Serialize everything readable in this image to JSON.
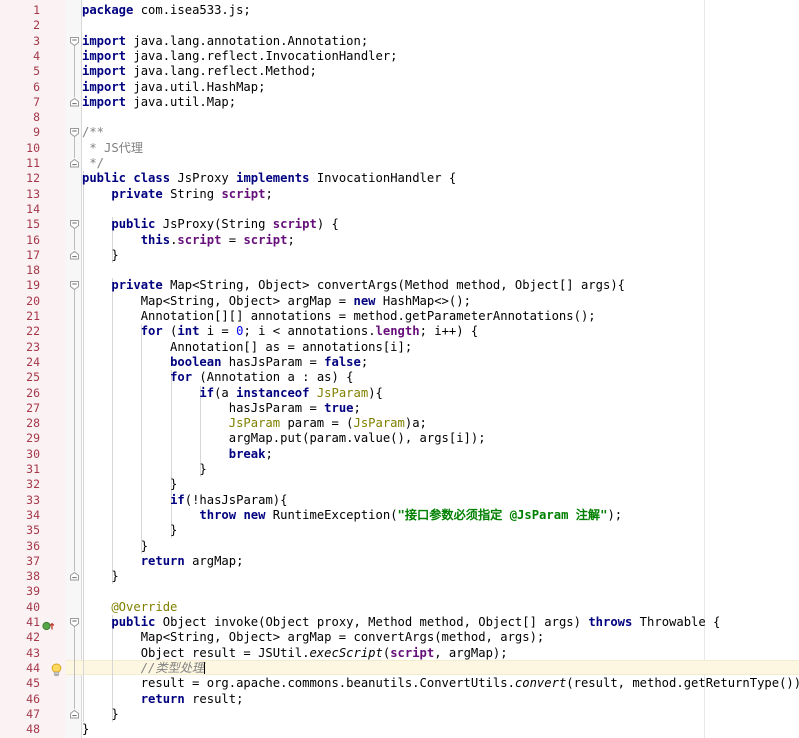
{
  "editor": {
    "language": "java",
    "file_package": "com.isea533.js",
    "class_name": "JsProxy",
    "colors": {
      "background": "#ffffff",
      "gutter_background": "#fbf2f4",
      "line_number": "#a5394a",
      "keyword": "#000080",
      "string": "#008000",
      "comment": "#808080",
      "annotation": "#808000",
      "field": "#660e7a",
      "number": "#0000ff",
      "caret_line": "#fdf7e2"
    },
    "caret_line_number": 44,
    "first_line": 1,
    "last_line": 48,
    "lines": [
      {
        "n": 1,
        "text": "package com.isea533.js;"
      },
      {
        "n": 2,
        "text": ""
      },
      {
        "n": 3,
        "text": "import java.lang.annotation.Annotation;"
      },
      {
        "n": 4,
        "text": "import java.lang.reflect.InvocationHandler;"
      },
      {
        "n": 5,
        "text": "import java.lang.reflect.Method;"
      },
      {
        "n": 6,
        "text": "import java.util.HashMap;"
      },
      {
        "n": 7,
        "text": "import java.util.Map;"
      },
      {
        "n": 8,
        "text": ""
      },
      {
        "n": 9,
        "text": "/**"
      },
      {
        "n": 10,
        "text": " * JS代理"
      },
      {
        "n": 11,
        "text": " */"
      },
      {
        "n": 12,
        "text": "public class JsProxy implements InvocationHandler {"
      },
      {
        "n": 13,
        "text": "    private String script;"
      },
      {
        "n": 14,
        "text": ""
      },
      {
        "n": 15,
        "text": "    public JsProxy(String script) {"
      },
      {
        "n": 16,
        "text": "        this.script = script;"
      },
      {
        "n": 17,
        "text": "    }"
      },
      {
        "n": 18,
        "text": ""
      },
      {
        "n": 19,
        "text": "    private Map<String, Object> convertArgs(Method method, Object[] args){"
      },
      {
        "n": 20,
        "text": "        Map<String, Object> argMap = new HashMap<>();"
      },
      {
        "n": 21,
        "text": "        Annotation[][] annotations = method.getParameterAnnotations();"
      },
      {
        "n": 22,
        "text": "        for (int i = 0; i < annotations.length; i++) {"
      },
      {
        "n": 23,
        "text": "            Annotation[] as = annotations[i];"
      },
      {
        "n": 24,
        "text": "            boolean hasJsParam = false;"
      },
      {
        "n": 25,
        "text": "            for (Annotation a : as) {"
      },
      {
        "n": 26,
        "text": "                if(a instanceof JsParam){"
      },
      {
        "n": 27,
        "text": "                    hasJsParam = true;"
      },
      {
        "n": 28,
        "text": "                    JsParam param = (JsParam)a;"
      },
      {
        "n": 29,
        "text": "                    argMap.put(param.value(), args[i]);"
      },
      {
        "n": 30,
        "text": "                    break;"
      },
      {
        "n": 31,
        "text": "                }"
      },
      {
        "n": 32,
        "text": "            }"
      },
      {
        "n": 33,
        "text": "            if(!hasJsParam){"
      },
      {
        "n": 34,
        "text": "                throw new RuntimeException(\"接口参数必须指定 @JsParam 注解\");"
      },
      {
        "n": 35,
        "text": "            }"
      },
      {
        "n": 36,
        "text": "        }"
      },
      {
        "n": 37,
        "text": "        return argMap;"
      },
      {
        "n": 38,
        "text": "    }"
      },
      {
        "n": 39,
        "text": ""
      },
      {
        "n": 40,
        "text": "    @Override"
      },
      {
        "n": 41,
        "text": "    public Object invoke(Object proxy, Method method, Object[] args) throws Throwable {"
      },
      {
        "n": 42,
        "text": "        Map<String, Object> argMap = convertArgs(method, args);"
      },
      {
        "n": 43,
        "text": "        Object result = JSUtil.execScript(script, argMap);"
      },
      {
        "n": 44,
        "text": "        //类型处理"
      },
      {
        "n": 45,
        "text": "        result = org.apache.commons.beanutils.ConvertUtils.convert(result, method.getReturnType());"
      },
      {
        "n": 46,
        "text": "        return result;"
      },
      {
        "n": 47,
        "text": "    }"
      },
      {
        "n": 48,
        "text": "}"
      }
    ],
    "gutter_markers": [
      {
        "line": 41,
        "icon": "override-method-icon",
        "tooltip": "Implements method"
      },
      {
        "line": 44,
        "icon": "intention-bulb-icon",
        "tooltip": "Show intention actions"
      }
    ],
    "fold_markers": [
      {
        "line": 3,
        "state": "expanded-top"
      },
      {
        "line": 7,
        "state": "expanded-bottom"
      },
      {
        "line": 9,
        "state": "expanded-top"
      },
      {
        "line": 11,
        "state": "expanded-bottom"
      },
      {
        "line": 15,
        "state": "expanded-top"
      },
      {
        "line": 17,
        "state": "expanded-bottom"
      },
      {
        "line": 19,
        "state": "expanded-top"
      },
      {
        "line": 38,
        "state": "expanded-bottom"
      },
      {
        "line": 41,
        "state": "expanded-top"
      },
      {
        "line": 47,
        "state": "expanded-bottom"
      }
    ]
  }
}
